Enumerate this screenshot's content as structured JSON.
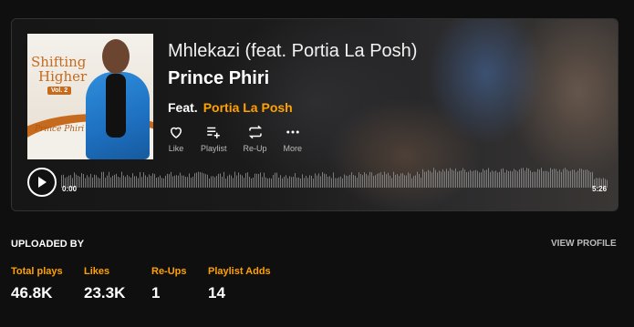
{
  "player": {
    "song_title": "Mhlekazi (feat. Portia La Posh)",
    "artist": "Prince Phiri",
    "feat_label": "Feat.",
    "feat_artist": "Portia La Posh",
    "cover": {
      "title_line1": "Shifting",
      "title_line2": "Higher",
      "volume": "Vol. 2",
      "signature": "Prince Phiri"
    },
    "actions": [
      {
        "label": "Like",
        "icon": "heart-icon"
      },
      {
        "label": "Playlist",
        "icon": "playlist-add-icon"
      },
      {
        "label": "Re-Up",
        "icon": "repeat-icon"
      },
      {
        "label": "More",
        "icon": "more-dots-icon"
      }
    ],
    "time_current": "0:00",
    "time_total": "5:26",
    "progress": 0
  },
  "uploader": {
    "heading": "UPLOADED BY",
    "view_profile": "VIEW PROFILE"
  },
  "stats": [
    {
      "label": "Total plays",
      "value": "46.8K"
    },
    {
      "label": "Likes",
      "value": "23.3K"
    },
    {
      "label": "Re-Ups",
      "value": "1"
    },
    {
      "label": "Playlist Adds",
      "value": "14"
    }
  ],
  "colors": {
    "accent": "#ffa200",
    "background": "#0f0f0f"
  }
}
